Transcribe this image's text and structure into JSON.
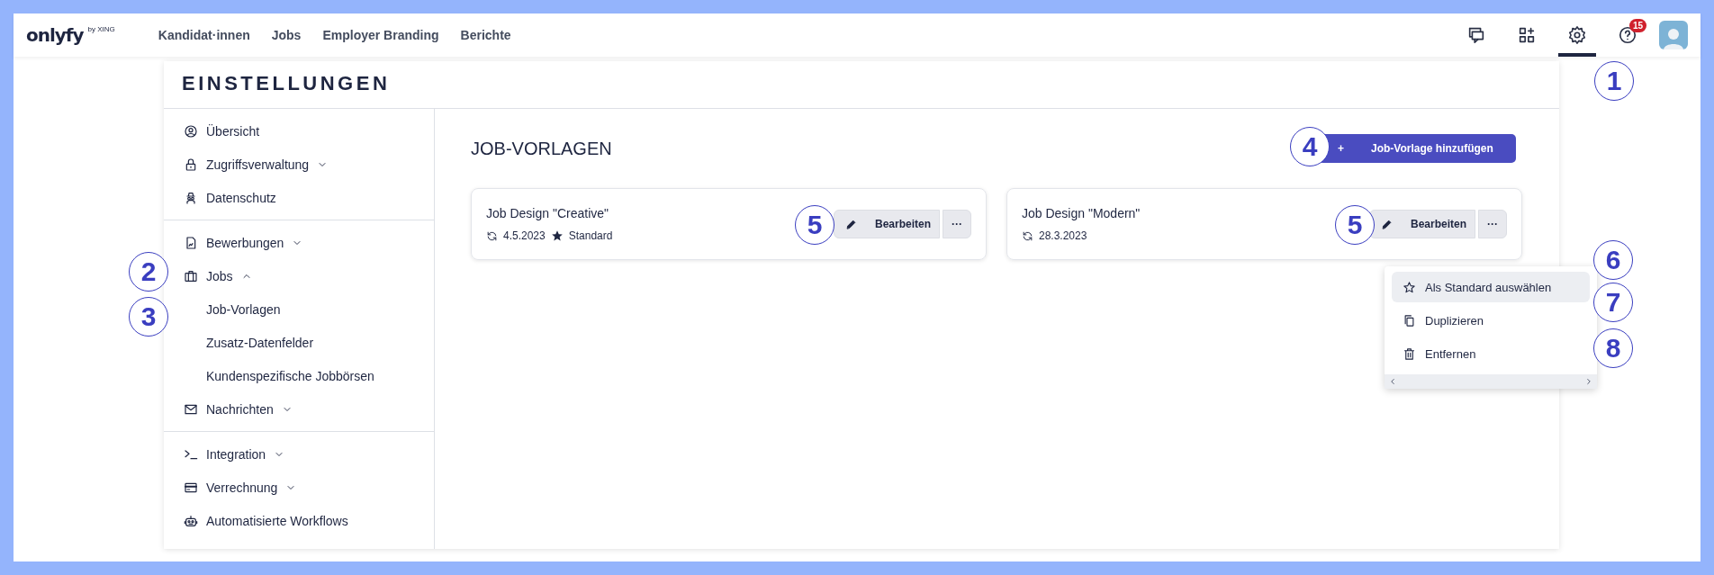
{
  "topbar": {
    "logo": "onlyfy",
    "logo_suffix": "by XING",
    "nav": [
      {
        "label": "Kandidat·innen"
      },
      {
        "label": "Jobs"
      },
      {
        "label": "Employer Branding"
      },
      {
        "label": "Berichte"
      }
    ],
    "icons": [
      {
        "selected": false
      },
      {
        "selected": false
      },
      {
        "selected": true
      },
      {
        "selected": false,
        "badge": "15"
      }
    ]
  },
  "page": {
    "title": "EINSTELLUNGEN"
  },
  "sidebar": {
    "groups": [
      {
        "items": [
          {
            "label": "Übersicht"
          },
          {
            "label": "Zugriffsverwaltung",
            "expanded": false
          },
          {
            "label": "Datenschutz"
          }
        ]
      },
      {
        "items": [
          {
            "label": "Bewerbungen",
            "expanded": false
          },
          {
            "label": "Jobs",
            "expanded": true,
            "children": [
              {
                "label": "Job-Vorlagen"
              },
              {
                "label": "Zusatz-Datenfelder"
              },
              {
                "label": "Kundenspezifische Jobbörsen"
              }
            ]
          },
          {
            "label": "Nachrichten",
            "expanded": false
          }
        ]
      },
      {
        "items": [
          {
            "label": "Integration",
            "expanded": false
          },
          {
            "label": "Verrechnung",
            "expanded": false
          },
          {
            "label": "Automatisierte Workflows"
          }
        ]
      }
    ]
  },
  "content": {
    "title": "JOB-VORLAGEN",
    "add_button": {
      "icon": "+",
      "label": "Job-Vorlage hinzufügen"
    },
    "cards": [
      {
        "title": "Job Design \"Creative\"",
        "date": "4.5.2023",
        "badge": "Standard",
        "edit_label": "Bearbeiten",
        "more_label": "···"
      },
      {
        "title": "Job Design \"Modern\"",
        "date": "28.3.2023",
        "edit_label": "Bearbeiten",
        "more_label": "···"
      }
    ],
    "menu": [
      {
        "label": "Als Standard auswählen",
        "highlighted": true
      },
      {
        "label": "Duplizieren",
        "highlighted": false
      },
      {
        "label": "Entfernen",
        "highlighted": false
      }
    ]
  },
  "callouts": [
    {
      "number": "1"
    },
    {
      "number": "2"
    },
    {
      "number": "3"
    },
    {
      "number": "4"
    },
    {
      "number": "5"
    },
    {
      "number": "5"
    },
    {
      "number": "6"
    },
    {
      "number": "7"
    },
    {
      "number": "8"
    }
  ]
}
